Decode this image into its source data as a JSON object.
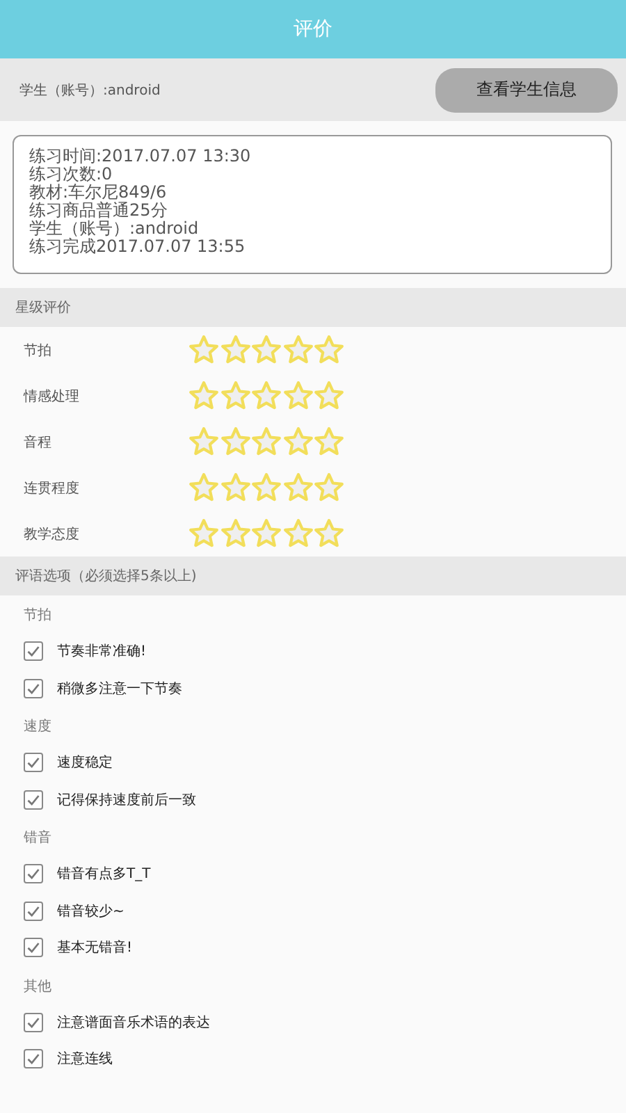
{
  "header": {
    "title": "评价"
  },
  "student": {
    "label": "学生（账号）:android",
    "button": "查看学生信息"
  },
  "info_lines": [
    "练习时间:2017.07.07 13:30",
    "练习次数:0",
    "教材:车尔尼849/6",
    "练习商品普通25分",
    "学生（账号）:android",
    "练习完成2017.07.07 13:55"
  ],
  "ratings": {
    "heading": "星级评价",
    "items": [
      {
        "label": "节拍",
        "stars": 0
      },
      {
        "label": "情感处理",
        "stars": 0
      },
      {
        "label": "音程",
        "stars": 0
      },
      {
        "label": "连贯程度",
        "stars": 0
      },
      {
        "label": "教学态度",
        "stars": 0
      }
    ]
  },
  "comments": {
    "heading": "评语选项（必须选择5条以上)",
    "groups": [
      {
        "heading": "节拍",
        "options": [
          {
            "label": "节奏非常准确!",
            "checked": true
          },
          {
            "label": "稍微多注意一下节奏",
            "checked": true
          }
        ]
      },
      {
        "heading": "速度",
        "options": [
          {
            "label": "速度稳定",
            "checked": true
          },
          {
            "label": "记得保持速度前后一致",
            "checked": true
          }
        ]
      },
      {
        "heading": "错音",
        "options": [
          {
            "label": "错音有点多T_T",
            "checked": true
          },
          {
            "label": "错音较少~",
            "checked": true
          },
          {
            "label": "基本无错音!",
            "checked": true
          }
        ]
      },
      {
        "heading": "其他",
        "options": [
          {
            "label": "注意谱面音乐术语的表达",
            "checked": true
          },
          {
            "label": "注意连线",
            "checked": true
          }
        ]
      }
    ]
  }
}
